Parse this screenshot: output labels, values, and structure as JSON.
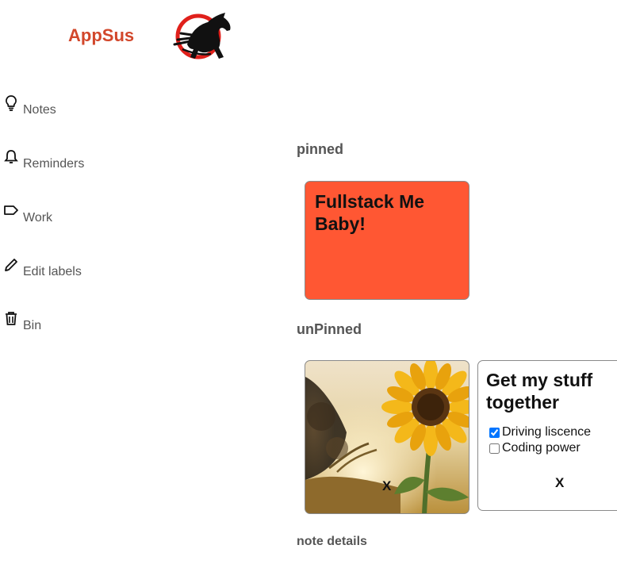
{
  "header": {
    "brand": "AppSus",
    "logo_icon": "horse-logo-icon"
  },
  "sidebar": {
    "items": [
      {
        "label": "Notes",
        "icon": "lightbulb-icon"
      },
      {
        "label": "Reminders",
        "icon": "bell-icon"
      },
      {
        "label": "Work",
        "icon": "label-tag-icon"
      },
      {
        "label": "Edit labels",
        "icon": "pencil-icon"
      },
      {
        "label": "Bin",
        "icon": "trash-icon"
      }
    ]
  },
  "main": {
    "pinned_title": "pinned",
    "unpinned_title": "unPinned",
    "details_title": "note details",
    "pinned_notes": [
      {
        "title": "Fullstack Me Baby!",
        "color": "#ff5733"
      }
    ],
    "unpinned_notes": [
      {
        "type": "image",
        "image": "sunflower-photo",
        "delete_label": "X"
      },
      {
        "type": "todos",
        "title": "Get my stuff together",
        "todos": [
          {
            "text": "Driving liscence",
            "done": true
          },
          {
            "text": "Coding power",
            "done": false
          }
        ],
        "delete_label": "X"
      }
    ]
  },
  "colors": {
    "brand": "#d2472b",
    "pinned_note": "#ff5733",
    "section_text": "#555555"
  }
}
